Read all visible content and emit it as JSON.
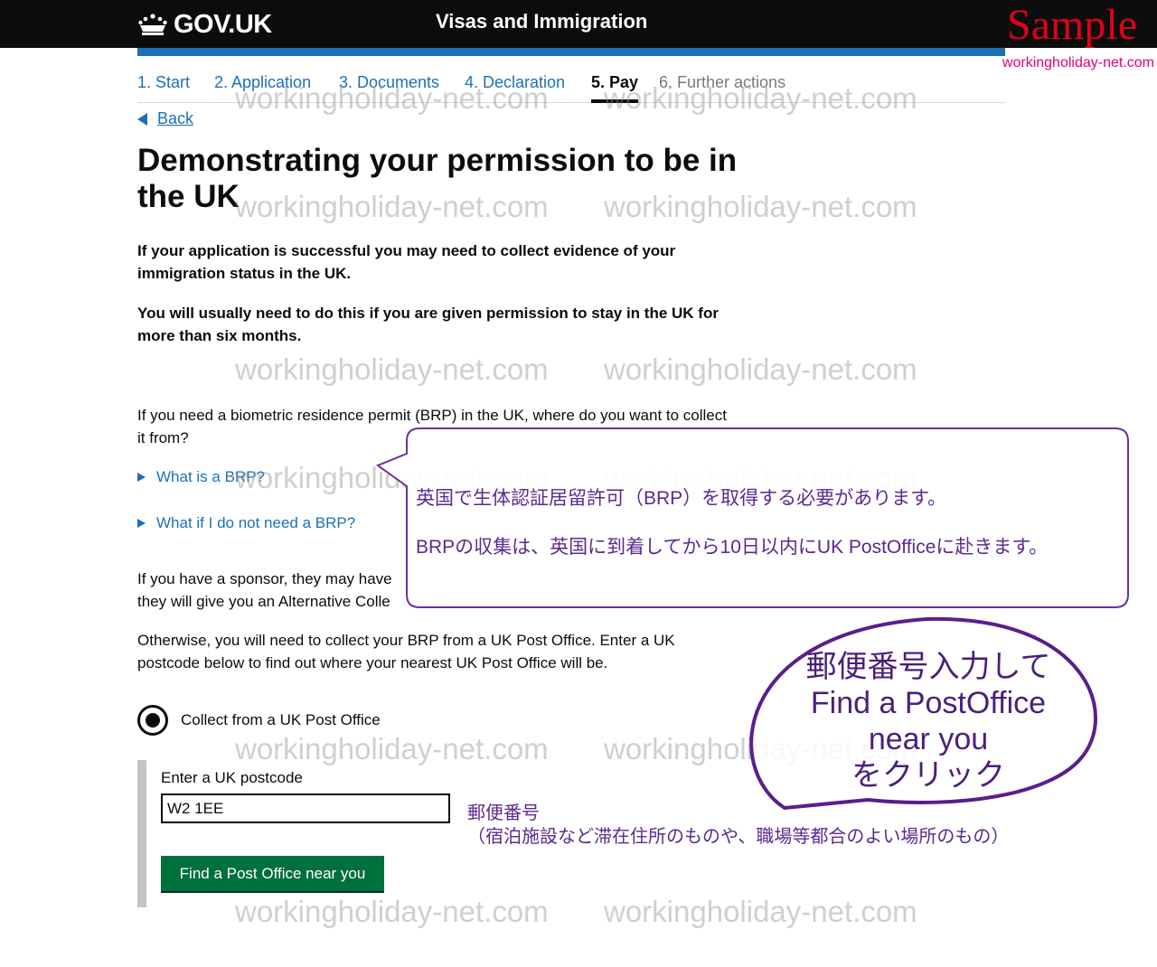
{
  "header": {
    "logo_text": "GOV.UK",
    "service_name": "Visas and Immigration",
    "colors": {
      "bar": "#0b0c0c",
      "accent": "#1d70b8"
    }
  },
  "sample": {
    "label": "Sample",
    "site": "workingholiday-net.com"
  },
  "steps": [
    {
      "label": "1. Start",
      "state": "link"
    },
    {
      "label": "2. Application",
      "state": "link"
    },
    {
      "label": "3. Documents",
      "state": "link"
    },
    {
      "label": "4. Declaration",
      "state": "link"
    },
    {
      "label": "5. Pay",
      "state": "current"
    },
    {
      "label": "6. Further actions",
      "state": "disabled"
    }
  ],
  "back_link": "Back",
  "page": {
    "title": "Demonstrating your permission to be in the UK",
    "lead1": "If your application is successful you may need to collect evidence of your immigration status in the UK.",
    "lead2": "You will usually need to do this if you are given permission to stay in the UK for more than six months.",
    "question": "If you need a biometric residence permit (BRP) in the UK, where do you want to collect it from?",
    "details1": "What is a BRP?",
    "details2": "What if I do not need a BRP?",
    "sponsor_line1": "If you have a sponsor, they may have",
    "sponsor_line2": "they will give you an Alternative Colle",
    "otherwise": "Otherwise, you will need to collect your BRP from a UK Post Office. Enter a UK postcode below to find out where your nearest UK Post Office will be.",
    "radio_label": "Collect from a UK Post Office",
    "radio_checked": true,
    "postcode_label": "Enter a UK postcode",
    "postcode_value": "W2 1EE",
    "find_button": "Find a Post Office near you"
  },
  "callout": {
    "line1": "英国で生体認証居留許可（BRP）を取得する必要があります。",
    "line2": "BRPの収集は、英国に到着してから10日以内にUK PostOfficeに赴きます。"
  },
  "bubble": {
    "line1": "郵便番号入力して",
    "line2": "Find a PostOffice",
    "line3": "near you",
    "line4": "をクリック"
  },
  "postcode_note": {
    "line1": "郵便番号",
    "line2": "（宿泊施設など滞在住所のものや、職場等都合のよい場所のもの）"
  },
  "watermark": "workingholiday-net.com"
}
